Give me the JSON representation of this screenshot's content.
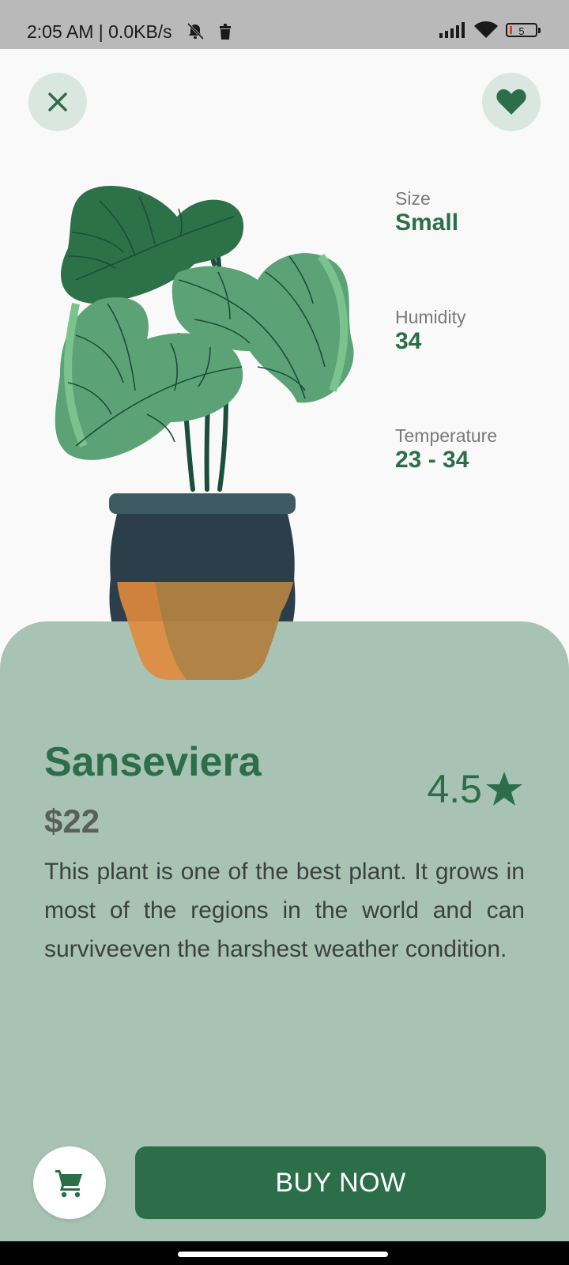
{
  "status_bar": {
    "time": "2:05 AM | 0.0KB/s",
    "battery_level": "5"
  },
  "header": {
    "close_icon": "close-icon",
    "favorite_icon": "heart-icon"
  },
  "specs": [
    {
      "label": "Size",
      "value": "Small"
    },
    {
      "label": "Humidity",
      "value": "34"
    },
    {
      "label": "Temperature",
      "value": "23 - 34"
    }
  ],
  "product": {
    "name": "Sanseviera",
    "price": "$22",
    "rating": "4.5",
    "description": "This plant is one of the best plant. It grows in most of the regions in the world and can surviveeven the harshest weather condition."
  },
  "actions": {
    "cart_icon": "cart-icon",
    "buy_label": "BUY NOW"
  },
  "colors": {
    "primary": "#2c6e49",
    "sheet": "#a8c3b4",
    "icon_bg": "#dae7e0"
  }
}
